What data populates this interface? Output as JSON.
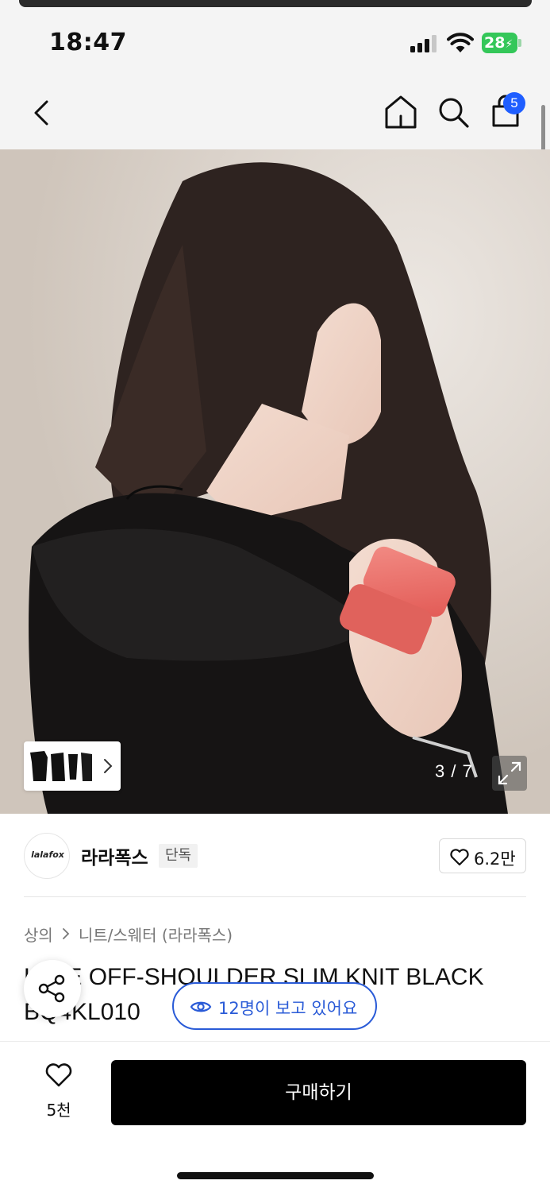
{
  "status_bar": {
    "time": "18:47",
    "battery_level": "28",
    "icons": [
      "signal-icon",
      "wifi-icon",
      "battery-charging-icon"
    ]
  },
  "nav": {
    "icons": [
      "chevron-left-icon",
      "home-icon",
      "search-icon",
      "shopping-bag-icon"
    ],
    "cart_count": "5"
  },
  "gallery": {
    "current_index": "3",
    "total": "7",
    "counter_text": "3 / 7",
    "expand_icon": "expand-icon"
  },
  "shop": {
    "logo_text": "lalafox",
    "name": "라라폭스",
    "tag": "단독",
    "likes": "6.2만"
  },
  "breadcrumb": {
    "category": "상의",
    "subcategory": "니트/스웨터 (라라폭스)"
  },
  "product": {
    "title": "LALE OFF-SHOULDER SLIM KNIT BLACK BQ4KL010"
  },
  "viewers": {
    "text": "12명이 보고 있어요"
  },
  "bottom": {
    "wish_count": "5천",
    "buy_label": "구매하기"
  },
  "colors": {
    "accent_blue": "#2a5bd7",
    "badge_blue": "#1f5eff",
    "battery_green": "#34c759",
    "buy_button": "#000000"
  }
}
